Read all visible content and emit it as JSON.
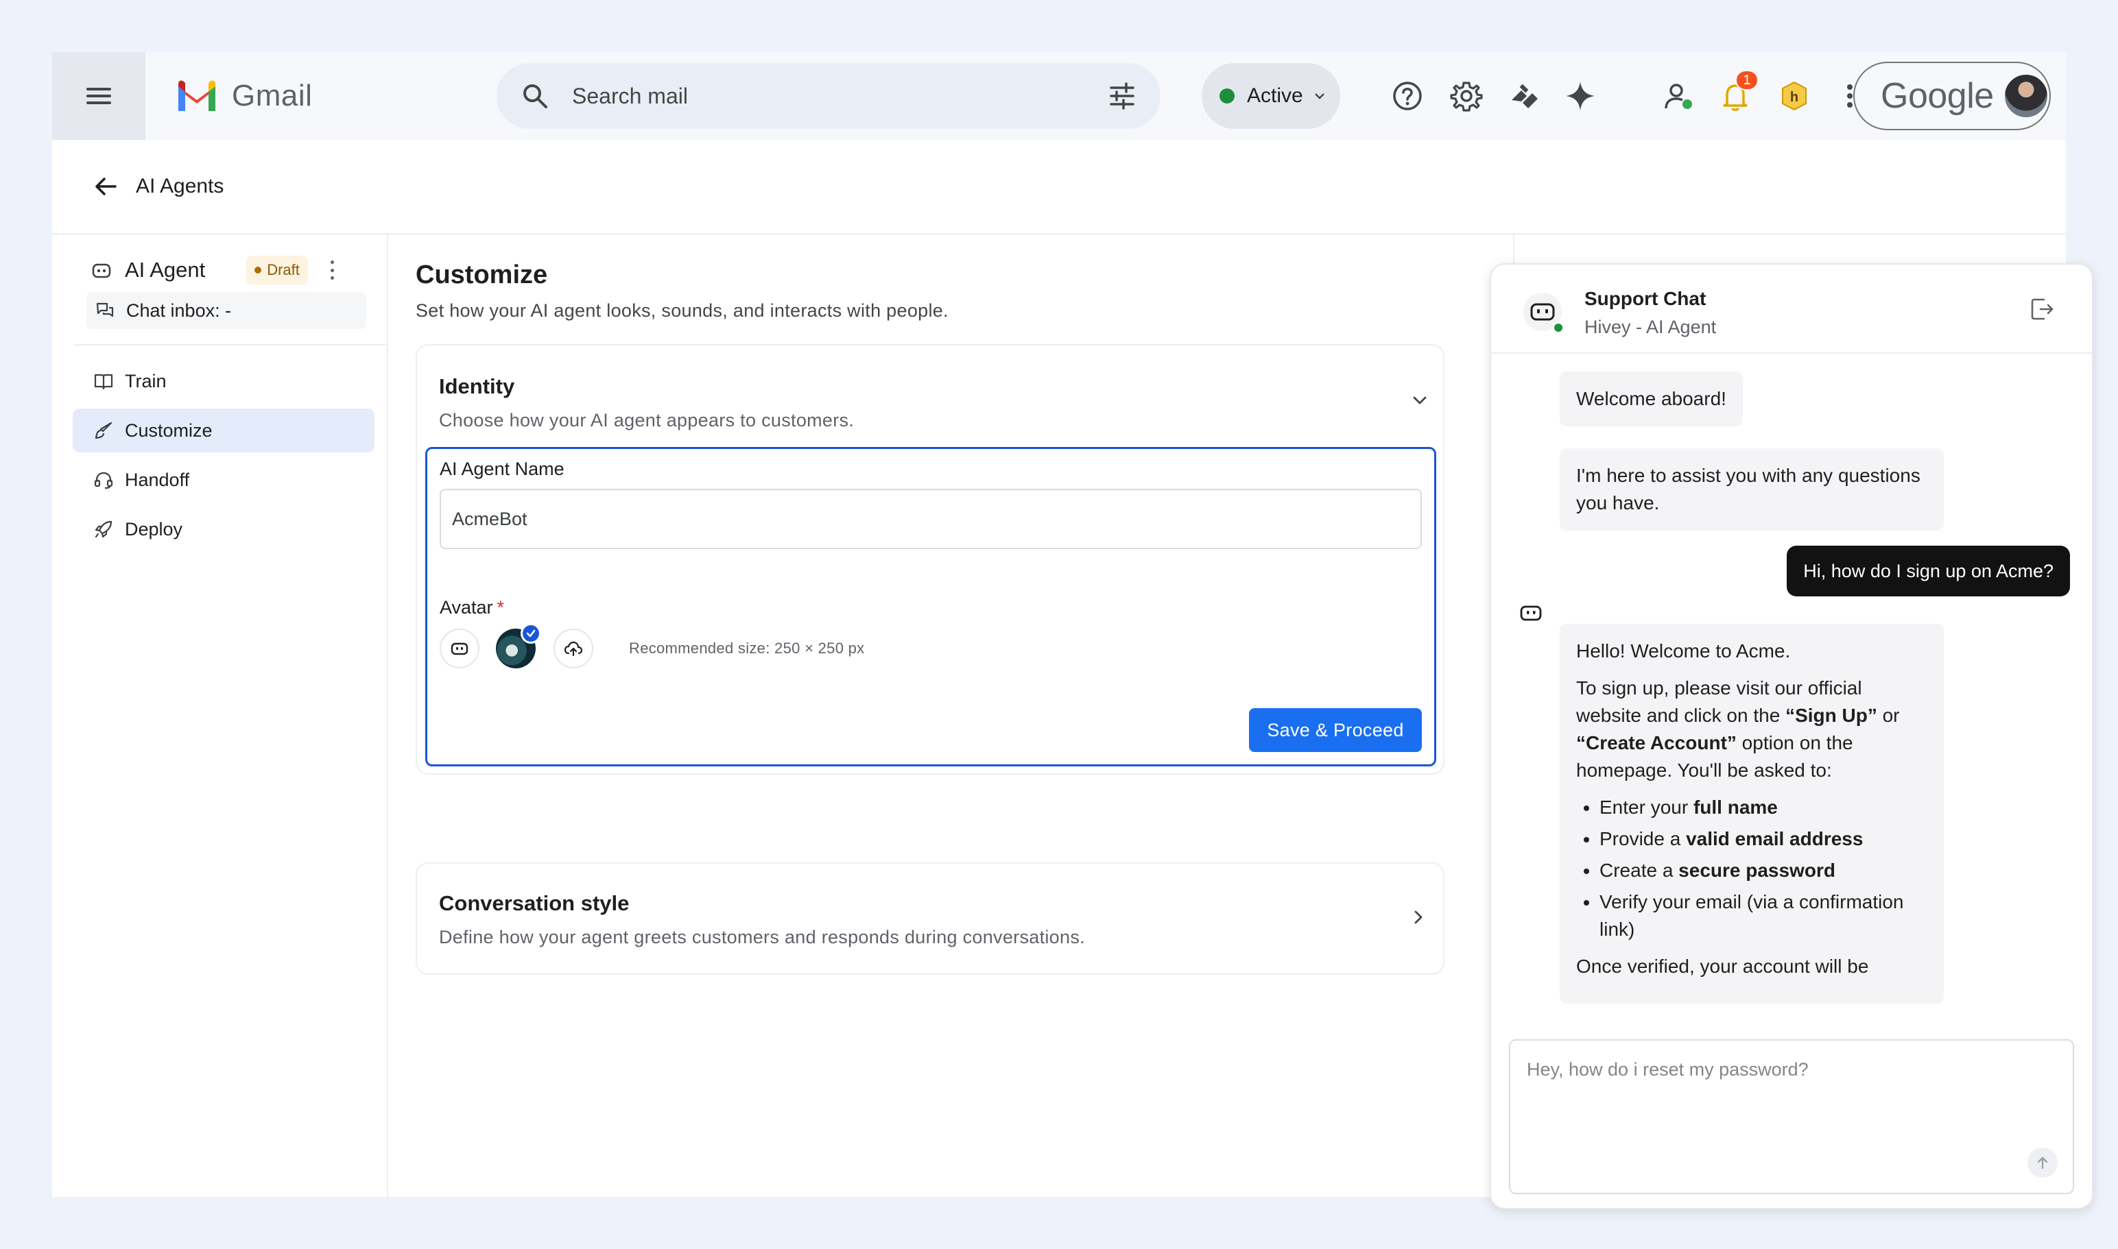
{
  "app": {
    "name": "Gmail"
  },
  "topbar": {
    "search_placeholder": "Search mail",
    "status_label": "Active",
    "notification_count": "1",
    "account_brand": "Google",
    "icons": [
      "menu-icon",
      "gmail-logo",
      "search-icon",
      "tune-icon",
      "help-icon",
      "settings-icon",
      "apps-script-icon",
      "gemini-icon",
      "contacts-icon",
      "bell-icon",
      "extension-icon",
      "apps-grid-icon"
    ]
  },
  "page": {
    "back_title": "AI Agents"
  },
  "sidebar": {
    "agent_name": "AI Agent",
    "draft_badge": "Draft",
    "chat_inbox": "Chat inbox: -",
    "nav": [
      {
        "label": "Train",
        "icon": "book-icon"
      },
      {
        "label": "Customize",
        "icon": "brush-icon",
        "active": true
      },
      {
        "label": "Handoff",
        "icon": "headset-icon"
      },
      {
        "label": "Deploy",
        "icon": "rocket-icon"
      }
    ]
  },
  "main": {
    "title": "Customize",
    "subtitle": "Set how your AI agent looks, sounds, and interacts with people.",
    "identity": {
      "title": "Identity",
      "subtitle": "Choose how your AI agent appears to customers.",
      "name_label": "AI Agent Name",
      "name_value": "AcmeBot",
      "avatar_label": "Avatar",
      "required_mark": "*",
      "recommended": "Recommended size: 250 × 250 px",
      "save_button": "Save & Proceed"
    },
    "conversation": {
      "title": "Conversation style",
      "subtitle": "Define how your agent greets customers and responds during conversations."
    }
  },
  "chat": {
    "title": "Support Chat",
    "subtitle": "Hivey - AI Agent",
    "messages": {
      "bot1": "Welcome aboard!",
      "bot2": "I'm here to assist you with any questions you have.",
      "user1": "Hi, how do I sign up on Acme?",
      "reply_intro": "Hello! Welcome to Acme.",
      "reply_p1_a": "To sign up, please visit our official website and click on the ",
      "reply_p1_signup": "“Sign Up”",
      "reply_p1_b": " or ",
      "reply_p1_create": "“Create Account”",
      "reply_p1_c": " option on the homepage. You'll be asked to:",
      "list": [
        {
          "pre": "Enter your ",
          "bold": "full name",
          "post": ""
        },
        {
          "pre": "Provide a ",
          "bold": "valid email address",
          "post": ""
        },
        {
          "pre": "Create a ",
          "bold": "secure password",
          "post": ""
        },
        {
          "pre": "Verify your email (via a confirmation link)",
          "bold": "",
          "post": ""
        }
      ],
      "reply_tail": "Once verified, your account will be"
    },
    "input_placeholder": "Hey, how do i reset my password?"
  }
}
